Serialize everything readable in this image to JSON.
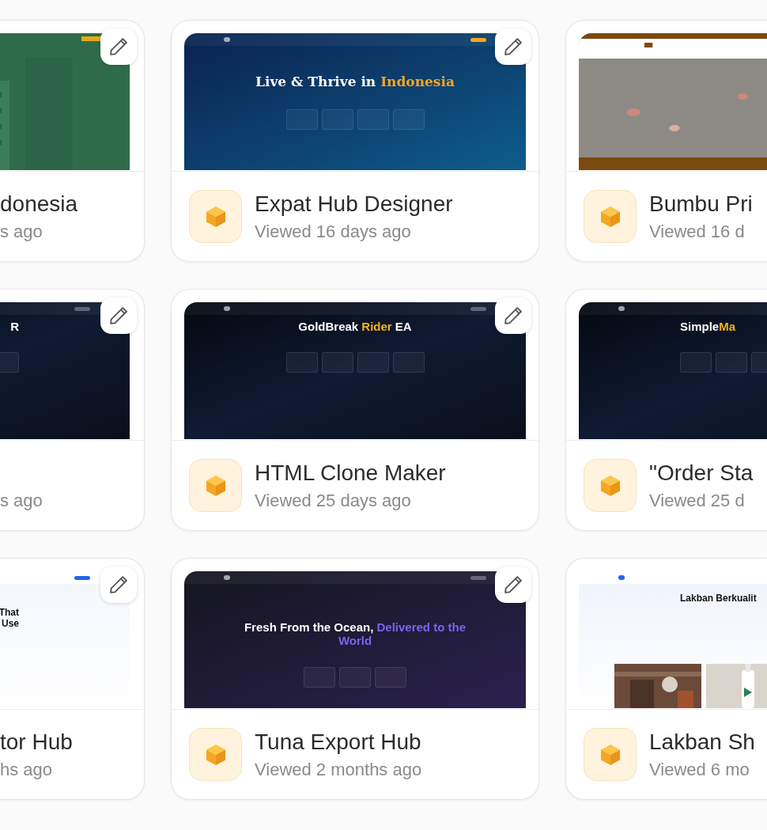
{
  "rows": [
    {
      "cards": [
        {
          "title": "donesia",
          "subtitle": "s ago",
          "editable": true,
          "thumbnail": {
            "kind": "forest"
          }
        },
        {
          "title": "Expat Hub Designer",
          "subtitle": "Viewed 16 days ago",
          "editable": true,
          "thumbnail": {
            "kind": "navy",
            "headline": [
              [
                {
                  "text": "Live & Thrive in ",
                  "accent": false
                },
                {
                  "text": "Indonesia",
                  "accent": true
                }
              ]
            ]
          }
        },
        {
          "title": "Bumbu Pri",
          "subtitle": "Viewed 16 d",
          "thumbnail": {
            "kind": "food"
          }
        }
      ]
    },
    {
      "cards": [
        {
          "subtitle": "s ago",
          "editable": true,
          "thumbnail": {
            "kind": "dark",
            "headline": [
              [
                {
                  "text": "R",
                  "accent": false
                }
              ]
            ]
          }
        },
        {
          "title": "HTML Clone Maker",
          "subtitle": "Viewed 25 days ago",
          "editable": true,
          "thumbnail": {
            "kind": "dark",
            "headline": [
              [
                {
                  "text": "GoldBreak ",
                  "accent": false
                },
                {
                  "text": "Rider",
                  "accent": true
                },
                {
                  "text": " EA",
                  "accent": false
                }
              ]
            ]
          }
        },
        {
          "title": "\"Order Sta",
          "subtitle": "Viewed 25 d",
          "thumbnail": {
            "kind": "dark",
            "headline": [
              [
                {
                  "text": "Simple",
                  "accent": false
                },
                {
                  "text": "Ma",
                  "accent": true
                }
              ]
            ]
          }
        }
      ]
    },
    {
      "cards": [
        {
          "title": "tor Hub",
          "subtitle": "hs ago",
          "editable": true,
          "thumbnail": {
            "kind": "light",
            "headline": [
              [
                {
                  "text": "That",
                  "accent": false
                }
              ],
              [
                {
                  "text": "Use",
                  "accent": false
                }
              ]
            ]
          }
        },
        {
          "title": "Tuna Export Hub",
          "subtitle": "Viewed 2 months ago",
          "editable": true,
          "thumbnail": {
            "kind": "purple",
            "headline": [
              [
                {
                  "text": "Fresh From the Ocean, ",
                  "accent": false
                },
                {
                  "text": "Delivered to the",
                  "accent": true
                }
              ],
              [
                {
                  "text": "World",
                  "accent": true
                }
              ]
            ]
          }
        },
        {
          "title": "Lakban Sh",
          "subtitle": "Viewed 6 mo",
          "thumbnail": {
            "kind": "shop",
            "headline": [
              [
                {
                  "text": "Lakban Berkualit",
                  "accent": false
                }
              ]
            ]
          }
        }
      ]
    }
  ]
}
